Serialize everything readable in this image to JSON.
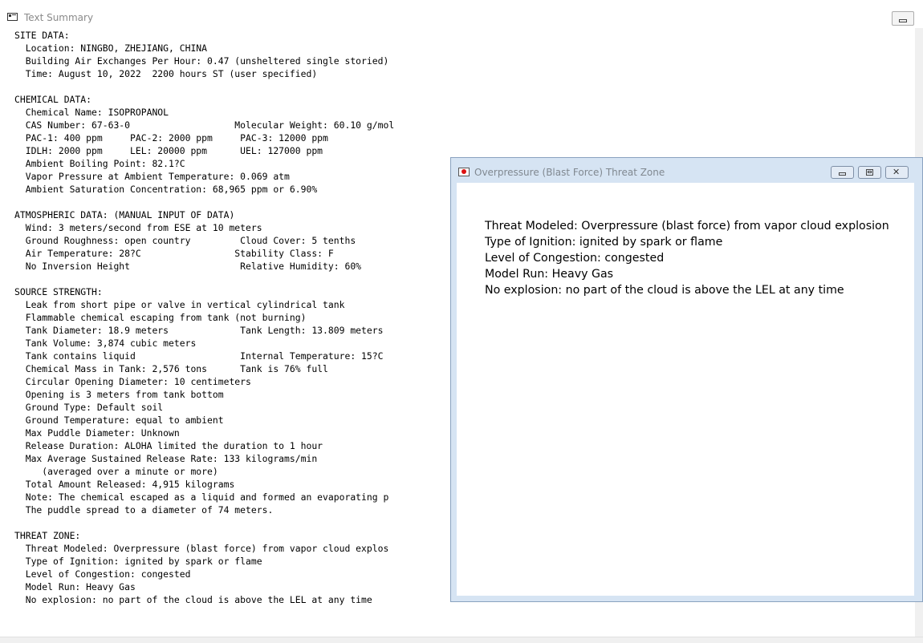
{
  "main_window": {
    "title": "Text Summary",
    "lines": [
      "SITE DATA:",
      "  Location: NINGBO, ZHEJIANG, CHINA",
      "  Building Air Exchanges Per Hour: 0.47 (unsheltered single storied)",
      "  Time: August 10, 2022  2200 hours ST (user specified)",
      "",
      "CHEMICAL DATA:",
      "  Chemical Name: ISOPROPANOL",
      "  CAS Number: 67-63-0                   Molecular Weight: 60.10 g/mol",
      "  PAC-1: 400 ppm     PAC-2: 2000 ppm     PAC-3: 12000 ppm",
      "  IDLH: 2000 ppm     LEL: 20000 ppm      UEL: 127000 ppm",
      "  Ambient Boiling Point: 82.1?C",
      "  Vapor Pressure at Ambient Temperature: 0.069 atm",
      "  Ambient Saturation Concentration: 68,965 ppm or 6.90%",
      "",
      "ATMOSPHERIC DATA: (MANUAL INPUT OF DATA)",
      "  Wind: 3 meters/second from ESE at 10 meters",
      "  Ground Roughness: open country         Cloud Cover: 5 tenths",
      "  Air Temperature: 28?C                 Stability Class: F",
      "  No Inversion Height                    Relative Humidity: 60%",
      "",
      "SOURCE STRENGTH:",
      "  Leak from short pipe or valve in vertical cylindrical tank",
      "  Flammable chemical escaping from tank (not burning)",
      "  Tank Diameter: 18.9 meters             Tank Length: 13.809 meters",
      "  Tank Volume: 3,874 cubic meters",
      "  Tank contains liquid                   Internal Temperature: 15?C",
      "  Chemical Mass in Tank: 2,576 tons      Tank is 76% full",
      "  Circular Opening Diameter: 10 centimeters",
      "  Opening is 3 meters from tank bottom",
      "  Ground Type: Default soil",
      "  Ground Temperature: equal to ambient",
      "  Max Puddle Diameter: Unknown",
      "  Release Duration: ALOHA limited the duration to 1 hour",
      "  Max Average Sustained Release Rate: 133 kilograms/min",
      "     (averaged over a minute or more)",
      "  Total Amount Released: 4,915 kilograms",
      "  Note: The chemical escaped as a liquid and formed an evaporating p",
      "  The puddle spread to a diameter of 74 meters.",
      "",
      "THREAT ZONE:",
      "  Threat Modeled: Overpressure (blast force) from vapor cloud explos",
      "  Type of Ignition: ignited by spark or flame",
      "  Level of Congestion: congested",
      "  Model Run: Heavy Gas",
      "  No explosion: no part of the cloud is above the LEL at any time"
    ]
  },
  "threat_window": {
    "title": "Overpressure (Blast Force) Threat Zone",
    "lines": [
      "Threat Modeled: Overpressure (blast force) from vapor cloud explosion",
      "Type of Ignition: ignited by spark or flame",
      "Level of Congestion: congested",
      "Model Run: Heavy Gas",
      "No explosion: no part of the cloud is above the LEL at any time"
    ]
  },
  "icons": {
    "main_app": "text-summary-icon",
    "threat_app": "aloha-threat-icon",
    "minimize": "minimize-icon",
    "maximize": "maximize-icon",
    "close": "close-icon"
  }
}
